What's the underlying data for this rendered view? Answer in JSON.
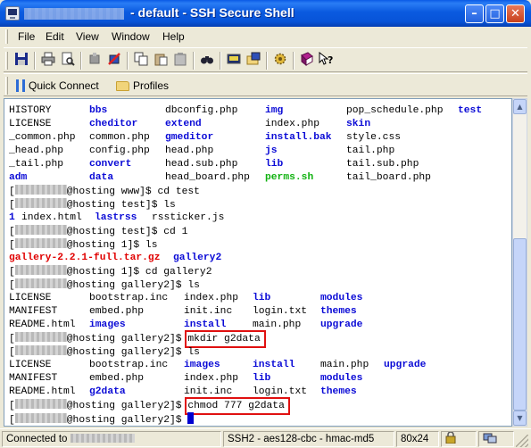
{
  "window": {
    "title": "- default - SSH Secure Shell"
  },
  "menu": [
    "File",
    "Edit",
    "View",
    "Window",
    "Help"
  ],
  "toolbar_icons": [
    "save-icon",
    "print-icon",
    "print-preview-icon",
    "connect-icon",
    "disconnect-icon",
    "copy-icon",
    "paste-icon",
    "paste-special-icon",
    "find-icon",
    "new-terminal-icon",
    "new-file-transfer-icon",
    "settings-icon",
    "help-book-icon",
    "context-help-icon"
  ],
  "profiles_bar": {
    "quick_connect": "Quick Connect",
    "profiles": "Profiles"
  },
  "terminal": {
    "lines": [
      [
        {
          "t": "HISTORY",
          "c": ""
        },
        {
          "t": "bbs",
          "c": "dir"
        },
        {
          "t": "dbconfig.php",
          "c": ""
        },
        {
          "t": "img",
          "c": "dir"
        },
        {
          "t": "pop_schedule.php",
          "c": ""
        },
        {
          "t": "test",
          "c": "dir"
        }
      ],
      [
        {
          "t": "LICENSE",
          "c": ""
        },
        {
          "t": "cheditor",
          "c": "dir"
        },
        {
          "t": "extend",
          "c": "dir"
        },
        {
          "t": "index.php",
          "c": ""
        },
        {
          "t": "skin",
          "c": "dir"
        }
      ],
      [
        {
          "t": "_common.php",
          "c": ""
        },
        {
          "t": "common.php",
          "c": ""
        },
        {
          "t": "gmeditor",
          "c": "dir"
        },
        {
          "t": "install.bak",
          "c": "dir"
        },
        {
          "t": "style.css",
          "c": ""
        }
      ],
      [
        {
          "t": "_head.php",
          "c": ""
        },
        {
          "t": "config.php",
          "c": ""
        },
        {
          "t": "head.php",
          "c": ""
        },
        {
          "t": "js",
          "c": "dir"
        },
        {
          "t": "tail.php",
          "c": ""
        }
      ],
      [
        {
          "t": "_tail.php",
          "c": ""
        },
        {
          "t": "convert",
          "c": "dir"
        },
        {
          "t": "head.sub.php",
          "c": ""
        },
        {
          "t": "lib",
          "c": "dir"
        },
        {
          "t": "tail.sub.php",
          "c": ""
        }
      ],
      [
        {
          "t": "adm",
          "c": "dir"
        },
        {
          "t": "data",
          "c": "dir"
        },
        {
          "t": "head_board.php",
          "c": ""
        },
        {
          "t": "perms.sh",
          "c": "exe"
        },
        {
          "t": "tail_board.php",
          "c": ""
        }
      ],
      {
        "prompt": "@hosting www]$ ",
        "cmd": "cd test"
      },
      {
        "prompt": "@hosting test]$ ",
        "cmd": "ls"
      },
      [
        {
          "t": "1",
          "c": "dir"
        },
        {
          "t": "index.html",
          "c": ""
        },
        {
          "t": "lastrss",
          "c": "dir"
        },
        {
          "t": "rssticker.js",
          "c": ""
        }
      ],
      {
        "prompt": "@hosting test]$ ",
        "cmd": "cd 1"
      },
      {
        "prompt": "@hosting 1]$ ",
        "cmd": "ls"
      },
      [
        {
          "t": "gallery-2.2.1-full.tar.gz",
          "c": "arc"
        },
        {
          "t": "gallery2",
          "c": "dir"
        }
      ],
      {
        "prompt": "@hosting 1]$ ",
        "cmd": "cd gallery2"
      },
      {
        "prompt": "@hosting gallery2]$ ",
        "cmd": "ls"
      },
      [
        {
          "t": "LICENSE",
          "c": ""
        },
        {
          "t": "bootstrap.inc",
          "c": ""
        },
        {
          "t": "index.php",
          "c": ""
        },
        {
          "t": "lib",
          "c": "dir"
        },
        {
          "t": "modules",
          "c": "dir"
        }
      ],
      [
        {
          "t": "MANIFEST",
          "c": ""
        },
        {
          "t": "embed.php",
          "c": ""
        },
        {
          "t": "init.inc",
          "c": ""
        },
        {
          "t": "login.txt",
          "c": ""
        },
        {
          "t": "themes",
          "c": "dir"
        }
      ],
      [
        {
          "t": "README.html",
          "c": ""
        },
        {
          "t": "images",
          "c": "dir"
        },
        {
          "t": "install",
          "c": "dir"
        },
        {
          "t": "main.php",
          "c": ""
        },
        {
          "t": "upgrade",
          "c": "dir"
        }
      ],
      {
        "prompt": "@hosting gallery2]$ ",
        "cmd": "mkdir g2data",
        "highlight": true
      },
      {
        "prompt": "@hosting gallery2]$ ",
        "cmd": "ls"
      },
      [
        {
          "t": "LICENSE",
          "c": ""
        },
        {
          "t": "bootstrap.inc",
          "c": ""
        },
        {
          "t": "images",
          "c": "dir"
        },
        {
          "t": "install",
          "c": "dir"
        },
        {
          "t": "main.php",
          "c": ""
        },
        {
          "t": "upgrade",
          "c": "dir"
        }
      ],
      [
        {
          "t": "MANIFEST",
          "c": ""
        },
        {
          "t": "embed.php",
          "c": ""
        },
        {
          "t": "index.php",
          "c": ""
        },
        {
          "t": "lib",
          "c": "dir"
        },
        {
          "t": "modules",
          "c": "dir"
        }
      ],
      [
        {
          "t": "README.html",
          "c": ""
        },
        {
          "t": "g2data",
          "c": "dir"
        },
        {
          "t": "init.inc",
          "c": ""
        },
        {
          "t": "login.txt",
          "c": ""
        },
        {
          "t": "themes",
          "c": "dir"
        }
      ],
      {
        "prompt": "@hosting gallery2]$ ",
        "cmd": "chmod 777 g2data",
        "highlight": true
      },
      {
        "prompt": "@hosting gallery2]$ ",
        "cmd": "",
        "cursor": true
      }
    ]
  },
  "status": {
    "connected": "Connected to",
    "cipher": "SSH2 - aes128-cbc - hmac-md5",
    "size": "80x24"
  }
}
